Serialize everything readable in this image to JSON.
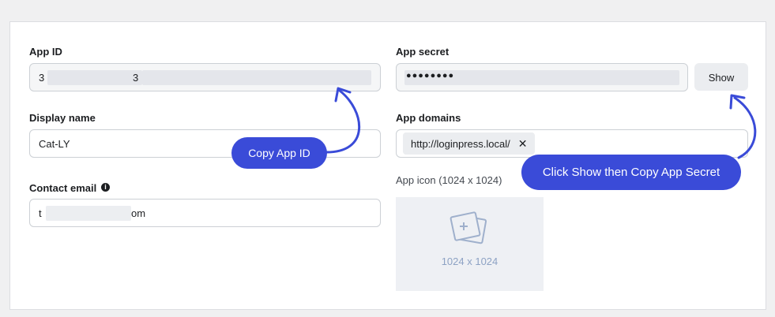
{
  "form": {
    "app_id": {
      "label": "App ID",
      "value_start": "3",
      "value_end": "3"
    },
    "display_name": {
      "label": "Display name",
      "value": "Cat-LY"
    },
    "contact_email": {
      "label": "Contact email",
      "value_start": "t",
      "value_end": "om"
    },
    "app_secret": {
      "label": "App secret",
      "value": "●●●●●●●●",
      "show_label": "Show"
    },
    "app_domains": {
      "label": "App domains",
      "chips": [
        {
          "text": "http://loginpress.local/",
          "remove": "✕"
        }
      ]
    },
    "app_icon": {
      "label": "App icon (1024 x 1024)",
      "placeholder_size": "1024 x 1024"
    }
  },
  "annotations": {
    "copy_app_id": "Copy App ID",
    "copy_secret": "Click Show then Copy App Secret",
    "color": "#3a4bd8"
  },
  "icons": {
    "info": "info-icon",
    "image_placeholder": "image-placeholder-icon",
    "remove": "close-icon"
  }
}
